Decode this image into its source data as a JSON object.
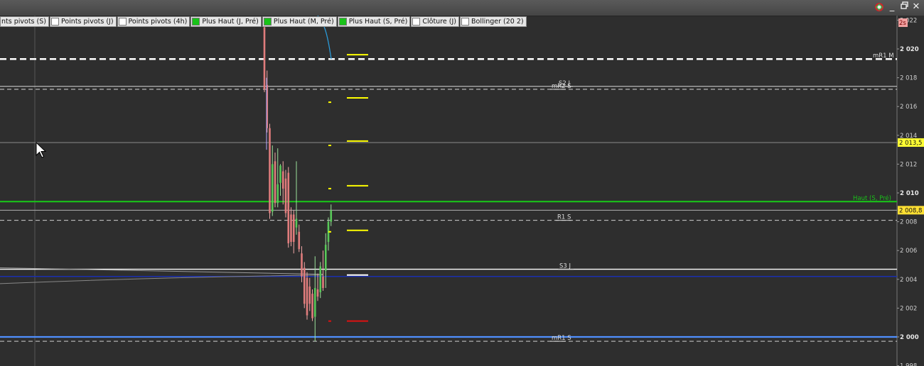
{
  "window": {
    "minimize": "_",
    "restore": "▫",
    "close": "✕",
    "logo_icon": "app-logo-icon"
  },
  "legend": [
    {
      "label": "nts pivots (S)",
      "checked": false,
      "color": "#ffffff"
    },
    {
      "label": "Points pivots (J)",
      "checked": false,
      "color": "#ffffff"
    },
    {
      "label": "Points pivots (4h)",
      "checked": false,
      "color": "#ffffff"
    },
    {
      "label": "Plus Haut (J, Pré)",
      "checked": true,
      "color": "#19c219"
    },
    {
      "label": "Plus Haut (M, Pré)",
      "checked": true,
      "color": "#19c219"
    },
    {
      "label": "Plus Haut (S, Pré)",
      "checked": true,
      "color": "#19c219"
    },
    {
      "label": "Clôture (J)",
      "checked": false,
      "color": "#ffffff"
    },
    {
      "label": "Bollinger (20 2)",
      "checked": false,
      "color": "#e0e0e0"
    }
  ],
  "chart_data": {
    "type": "candlestick",
    "y_range": [
      1998,
      2022
    ],
    "y_ticks": [
      {
        "value": 2022,
        "label": "2 022",
        "bold": false
      },
      {
        "value": 2020,
        "label": "2 020",
        "bold": true
      },
      {
        "value": 2018,
        "label": "2 018",
        "bold": false
      },
      {
        "value": 2016,
        "label": "2 016",
        "bold": false
      },
      {
        "value": 2014,
        "label": "2 014",
        "bold": false
      },
      {
        "value": 2012,
        "label": "2 012",
        "bold": false
      },
      {
        "value": 2010,
        "label": "2 010",
        "bold": true
      },
      {
        "value": 2008,
        "label": "2 008",
        "bold": false
      },
      {
        "value": 2006,
        "label": "2 006",
        "bold": false
      },
      {
        "value": 2004,
        "label": "2 004",
        "bold": false
      },
      {
        "value": 2002,
        "label": "2 002",
        "bold": false
      },
      {
        "value": 2000,
        "label": "2 000",
        "bold": true
      },
      {
        "value": 1998,
        "label": "1 998",
        "bold": false
      }
    ],
    "badges": [
      {
        "value": 2013.5,
        "label": "2 013,5",
        "bg": "#ffff33"
      },
      {
        "value": 2008.8,
        "label": "2 008,8",
        "bg": "#ffe033"
      }
    ],
    "timer_badge": "2s",
    "levels": [
      {
        "name": "mR1 M",
        "value": 2019.3,
        "color": "#ffffff",
        "style": "dashed-bold"
      },
      {
        "name": "S2 J",
        "value": 2017.4,
        "color": "#d8d8d8",
        "style": "solid-thin"
      },
      {
        "name": "mR2 S",
        "value": 2017.2,
        "color": "#d8d8d8",
        "style": "dashed"
      },
      {
        "name": "",
        "value": 2013.5,
        "color": "#8a8a8a",
        "style": "solid-thin"
      },
      {
        "name": "Haut (S, Pré)",
        "value": 2009.4,
        "color": "#19c219",
        "style": "solid-bold"
      },
      {
        "name": "",
        "value": 2008.8,
        "color": "#b0b0b0",
        "style": "solid-thin"
      },
      {
        "name": "R1 S",
        "value": 2008.1,
        "color": "#cfcfcf",
        "style": "dashed"
      },
      {
        "name": "S3 J",
        "value": 2004.7,
        "color": "#ffffff",
        "style": "solid"
      },
      {
        "name": "",
        "value": 2004.2,
        "color": "#1a2fb0",
        "style": "solid"
      },
      {
        "name": "",
        "value": 2000.0,
        "color": "#4f8fff",
        "style": "solid-bold"
      },
      {
        "name": "mR1 S",
        "value": 1999.7,
        "color": "#cfcfcf",
        "style": "dashed"
      }
    ],
    "grid_lines": [
      2022,
      2020,
      2018,
      2016,
      2014,
      2012,
      2010,
      2008,
      2006,
      2004,
      2002,
      2000,
      1998
    ],
    "candles": [
      {
        "o": 2021.5,
        "h": 2022,
        "l": 2017.0,
        "c": 2017.2
      },
      {
        "o": 2017.5,
        "h": 2018.5,
        "l": 2014.2,
        "c": 2014.5
      },
      {
        "o": 2014.5,
        "h": 2014.8,
        "l": 2008.2,
        "c": 2008.6
      },
      {
        "o": 2008.7,
        "h": 2013.3,
        "l": 2008.4,
        "c": 2012.0
      },
      {
        "o": 2012.2,
        "h": 2012.8,
        "l": 2009.0,
        "c": 2009.3
      },
      {
        "o": 2009.3,
        "h": 2013.1,
        "l": 2009.0,
        "c": 2010.6
      },
      {
        "o": 2010.7,
        "h": 2012.0,
        "l": 2009.8,
        "c": 2011.9
      },
      {
        "o": 2011.5,
        "h": 2012.2,
        "l": 2009.2,
        "c": 2010.3
      },
      {
        "o": 2011.0,
        "h": 2011.6,
        "l": 2008.3,
        "c": 2008.6
      },
      {
        "o": 2011.4,
        "h": 2011.8,
        "l": 2006.2,
        "c": 2006.5
      },
      {
        "o": 2008.5,
        "h": 2009.0,
        "l": 2006.3,
        "c": 2006.6
      },
      {
        "o": 2008.5,
        "h": 2008.8,
        "l": 2005.8,
        "c": 2006.6
      },
      {
        "o": 2007.6,
        "h": 2012.2,
        "l": 2007.1,
        "c": 2008.2
      },
      {
        "o": 2007.3,
        "h": 2007.8,
        "l": 2005.9,
        "c": 2006.1
      },
      {
        "o": 2005.8,
        "h": 2006.3,
        "l": 2003.8,
        "c": 2004.2
      },
      {
        "o": 2004.8,
        "h": 2005.2,
        "l": 2002.0,
        "c": 2002.3
      },
      {
        "o": 2004.1,
        "h": 2004.5,
        "l": 2001.2,
        "c": 2001.5
      },
      {
        "o": 2003.5,
        "h": 2004.1,
        "l": 2001.8,
        "c": 2002.3
      },
      {
        "o": 2003.0,
        "h": 2003.3,
        "l": 2001.1,
        "c": 2001.3
      },
      {
        "o": 2001.4,
        "h": 2005.6,
        "l": 1999.7,
        "c": 2003.4
      },
      {
        "o": 2003.3,
        "h": 2004.4,
        "l": 2002.5,
        "c": 2002.8
      },
      {
        "o": 2003.1,
        "h": 2005.2,
        "l": 2002.7,
        "c": 2004.9
      },
      {
        "o": 2004.2,
        "h": 2006.0,
        "l": 2003.2,
        "c": 2003.4
      },
      {
        "o": 2004.6,
        "h": 2007.2,
        "l": 2003.4,
        "c": 2006.4
      },
      {
        "o": 2006.6,
        "h": 2008.3,
        "l": 2006.0,
        "c": 2008.0
      },
      {
        "o": 2008.0,
        "h": 2009.2,
        "l": 2007.7,
        "c": 2008.8
      }
    ],
    "bollinger_upper_note": "curve descending to 2019.3",
    "markers": [
      {
        "value": 2019.6,
        "color": "#ffff00",
        "wide": true
      },
      {
        "value": 2016.6,
        "color": "#ffff00",
        "wide": true
      },
      {
        "value": 2016.3,
        "color": "#ffff00",
        "wide": false
      },
      {
        "value": 2013.6,
        "color": "#ffff00",
        "wide": true
      },
      {
        "value": 2013.3,
        "color": "#ffff00",
        "wide": false
      },
      {
        "value": 2010.5,
        "color": "#ffff00",
        "wide": true
      },
      {
        "value": 2010.3,
        "color": "#ffff00",
        "wide": false
      },
      {
        "value": 2007.4,
        "color": "#ffff00",
        "wide": true
      },
      {
        "value": 2007.3,
        "color": "#ffff00",
        "wide": false
      },
      {
        "value": 2004.3,
        "color": "#ffffff",
        "wide": true
      },
      {
        "value": 2001.1,
        "color": "#dd1111",
        "wide": true
      },
      {
        "value": 2001.1,
        "color": "#dd1111",
        "wide": false
      }
    ],
    "cursor_icon": "mouse-pointer-icon"
  }
}
